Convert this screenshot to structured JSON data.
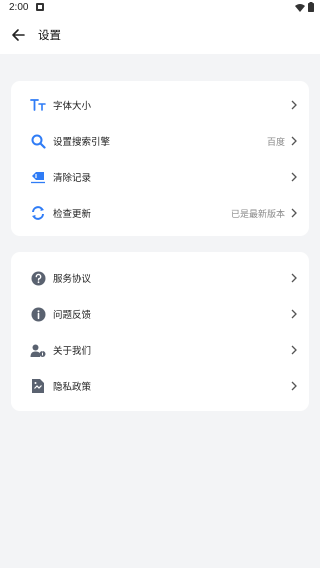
{
  "status_bar": {
    "time": "2:00"
  },
  "header": {
    "title": "设置"
  },
  "group1": [
    {
      "label": "字体大小",
      "value": "",
      "icon": "font-size-icon"
    },
    {
      "label": "设置搜索引擎",
      "value": "百度",
      "icon": "search-icon"
    },
    {
      "label": "清除记录",
      "value": "",
      "icon": "eraser-icon"
    },
    {
      "label": "检查更新",
      "value": "已是最新版本",
      "icon": "refresh-icon"
    }
  ],
  "group2": [
    {
      "label": "服务协议",
      "value": "",
      "icon": "question-icon"
    },
    {
      "label": "问题反馈",
      "value": "",
      "icon": "info-icon"
    },
    {
      "label": "关于我们",
      "value": "",
      "icon": "user-info-icon"
    },
    {
      "label": "隐私政策",
      "value": "",
      "icon": "document-icon"
    }
  ],
  "colors": {
    "accent": "#2f7cf6",
    "icon_gray": "#5a6270",
    "background": "#f3f4f6"
  }
}
